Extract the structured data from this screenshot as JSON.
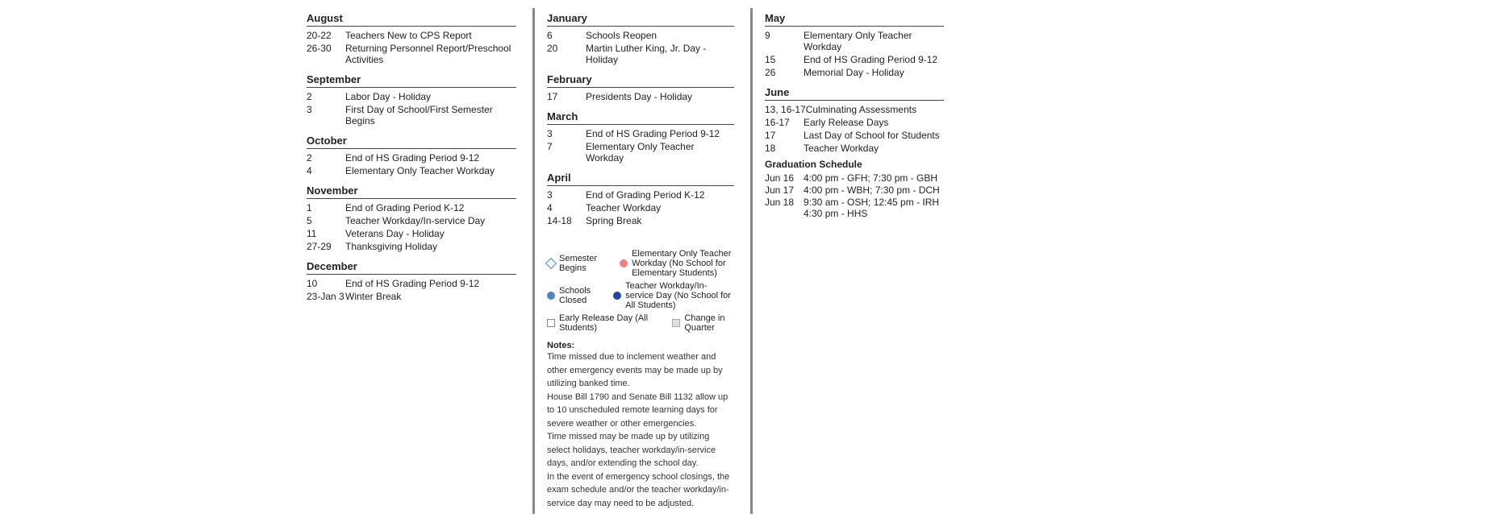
{
  "leftCol": {
    "months": [
      {
        "name": "August",
        "events": [
          {
            "date": "20-22",
            "event": "Teachers New to CPS Report"
          },
          {
            "date": "26-30",
            "event": "Returning Personnel Report/Preschool Activities"
          }
        ]
      },
      {
        "name": "September",
        "events": [
          {
            "date": "2",
            "event": "Labor Day - Holiday"
          },
          {
            "date": "3",
            "event": "First Day of School/First Semester Begins"
          }
        ]
      },
      {
        "name": "October",
        "events": [
          {
            "date": "2",
            "event": "End of HS Grading Period 9-12"
          },
          {
            "date": "4",
            "event": "Elementary Only Teacher Workday"
          }
        ]
      },
      {
        "name": "November",
        "events": [
          {
            "date": "1",
            "event": "End of Grading Period K-12"
          },
          {
            "date": "5",
            "event": "Teacher Workday/In-service Day"
          },
          {
            "date": "11",
            "event": "Veterans Day - Holiday"
          },
          {
            "date": "27-29",
            "event": "Thanksgiving Holiday"
          }
        ]
      },
      {
        "name": "December",
        "events": [
          {
            "date": "10",
            "event": "End of HS Grading Period 9-12"
          },
          {
            "date": "23-Jan 3",
            "event": "Winter Break"
          }
        ]
      }
    ]
  },
  "midCol": {
    "months": [
      {
        "name": "January",
        "events": [
          {
            "date": "6",
            "event": "Schools Reopen"
          },
          {
            "date": "20",
            "event": "Martin Luther King, Jr. Day - Holiday"
          }
        ]
      },
      {
        "name": "February",
        "events": [
          {
            "date": "17",
            "event": "Presidents Day - Holiday"
          }
        ]
      },
      {
        "name": "March",
        "events": [
          {
            "date": "3",
            "event": "End of HS Grading Period 9-12"
          },
          {
            "date": "7",
            "event": "Elementary Only Teacher Workday"
          }
        ]
      },
      {
        "name": "April",
        "events": [
          {
            "date": "3",
            "event": "End of Grading Period K-12"
          },
          {
            "date": "4",
            "event": "Teacher Workday"
          },
          {
            "date": "14-18",
            "event": "Spring Break"
          }
        ]
      }
    ]
  },
  "rightCol": {
    "months": [
      {
        "name": "May",
        "events": [
          {
            "date": "9",
            "event": "Elementary Only Teacher Workday"
          },
          {
            "date": "15",
            "event": "End of HS Grading Period 9-12"
          },
          {
            "date": "26",
            "event": "Memorial Day - Holiday"
          }
        ]
      },
      {
        "name": "June",
        "events": [
          {
            "date": "13, 16-17",
            "event": "Culminating Assessments"
          },
          {
            "date": "16-17",
            "event": "Early Release Days"
          },
          {
            "date": "17",
            "event": "Last Day of School for Students"
          },
          {
            "date": "18",
            "event": "Teacher Workday"
          }
        ]
      }
    ],
    "graduation": {
      "title": "Graduation Schedule",
      "events": [
        {
          "date": "Jun 16",
          "event": "4:00 pm - GFH; 7:30 pm - GBH"
        },
        {
          "date": "Jun 17",
          "event": "4:00 pm - WBH; 7:30 pm - DCH"
        },
        {
          "date": "Jun 18",
          "event": "9:30 am - OSH; 12:45 pm - IRH\n4:30 pm - HHS"
        }
      ]
    }
  },
  "legend": {
    "items": [
      {
        "type": "diamond",
        "label": "Semester Begins"
      },
      {
        "type": "circle-blue",
        "label": "Schools Closed"
      },
      {
        "type": "square",
        "label": "Early Release Day (All Students)"
      },
      {
        "type": "circle-pink",
        "label": "Elementary Only Teacher Workday (No School for Elementary Students)"
      },
      {
        "type": "circle-darkblue",
        "label": "Teacher Workday/In-service Day (No School for All Students)"
      },
      {
        "type": "square-gray",
        "label": "Change in Quarter"
      }
    ]
  },
  "notes": {
    "title": "Notes:",
    "lines": [
      "Time missed due to inclement weather and other emergency events may be made up by utilizing banked time.",
      "House Bill 1790 and Senate Bill 1132 allow up to 10 unscheduled remote learning days for severe weather or other emergencies.",
      "Time missed may be made up by utilizing select holidays, teacher workday/in-service days, and/or extending the school day.",
      "In the event of emergency school closings, the exam schedule and/or the teacher workday/in-service day may need to be adjusted."
    ]
  }
}
